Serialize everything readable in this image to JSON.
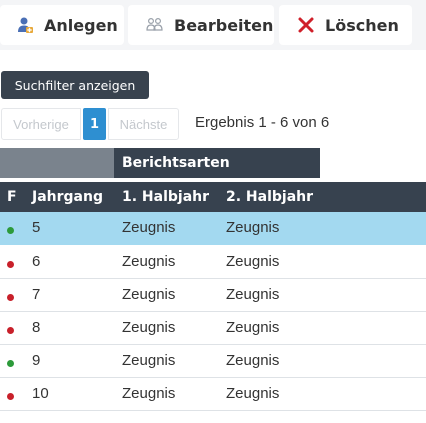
{
  "toolbar": {
    "anlegen_label": "Anlegen",
    "bearbeiten_label": "Bearbeiten",
    "loeschen_label": "Löschen"
  },
  "filter": {
    "label": "Suchfilter anzeigen"
  },
  "pagination": {
    "prev_label": "Vorherige",
    "current_page": "1",
    "next_label": "Nächste",
    "result_text": "Ergebnis 1 - 6 von 6"
  },
  "table": {
    "group_header": "Berichtsarten",
    "columns": [
      "F",
      "Jahrgang",
      "1. Halbjahr",
      "2. Halbjahr"
    ],
    "rows": [
      {
        "status": "green",
        "jahrgang": "5",
        "h1": "Zeugnis",
        "h2": "Zeugnis",
        "selected": true
      },
      {
        "status": "red",
        "jahrgang": "6",
        "h1": "Zeugnis",
        "h2": "Zeugnis",
        "selected": false
      },
      {
        "status": "red",
        "jahrgang": "7",
        "h1": "Zeugnis",
        "h2": "Zeugnis",
        "selected": false
      },
      {
        "status": "red",
        "jahrgang": "8",
        "h1": "Zeugnis",
        "h2": "Zeugnis",
        "selected": false
      },
      {
        "status": "green",
        "jahrgang": "9",
        "h1": "Zeugnis",
        "h2": "Zeugnis",
        "selected": false
      },
      {
        "status": "red",
        "jahrgang": "10",
        "h1": "Zeugnis",
        "h2": "Zeugnis",
        "selected": false
      }
    ]
  },
  "colors": {
    "status_green": "#2c9a3a",
    "status_red": "#c8202a",
    "selected_row": "#a3d9f0",
    "header_dark": "#37424f",
    "delete_icon": "#d0202a"
  }
}
